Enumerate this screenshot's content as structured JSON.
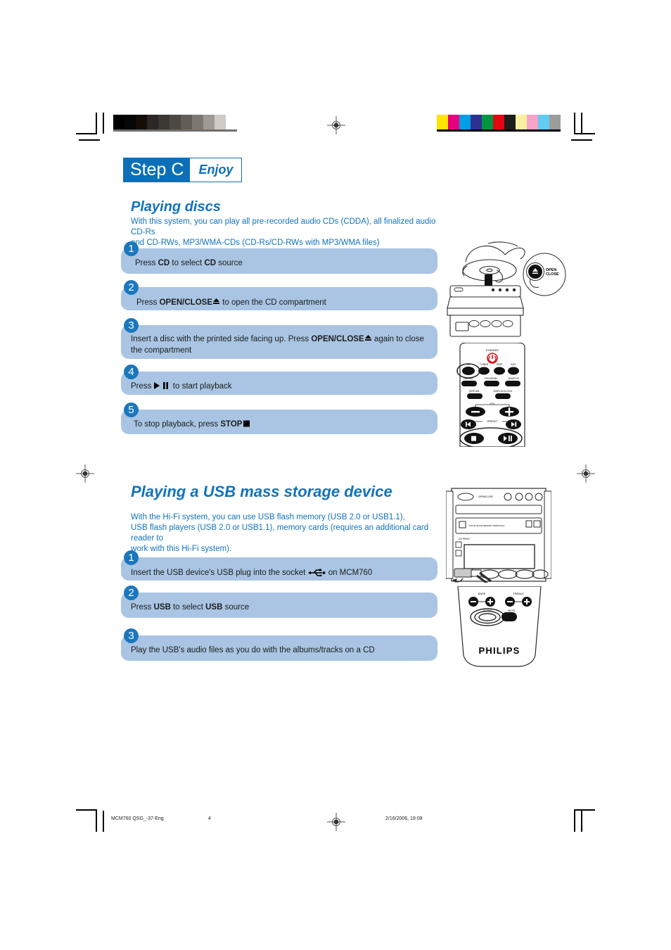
{
  "page": {
    "step_banner": {
      "step_label": "Step C",
      "enjoy_label": "Enjoy"
    },
    "calibration": {
      "gray_swatches": [
        "#000000",
        "#070707",
        "#140d08",
        "#2b2724",
        "#3b3733",
        "#4e4843",
        "#635c57",
        "#7e7771",
        "#a09a95",
        "#cfcac6",
        "#ffffff"
      ],
      "color_swatches": [
        "#ffe500",
        "#e6007e",
        "#009fe3",
        "#2e3192",
        "#009640",
        "#e30613",
        "#1d1d1b",
        "#fcf0a0",
        "#f5a3c7",
        "#62cbf2",
        "#9d9d9c"
      ]
    }
  },
  "discs": {
    "title": "Playing discs",
    "intro_line1": "With this system, you can play all pre-recorded audio CDs (CDDA), all finalized audio CD-Rs",
    "intro_line2": "and CD-RWs, MP3/WMA-CDs (CD-Rs/CD-RWs with MP3/WMA files)",
    "steps": [
      {
        "num": "1",
        "text_pre": "Press ",
        "bold1": "CD",
        "text_mid": " to select ",
        "bold2": "CD",
        "text_post": " source"
      },
      {
        "num": "2",
        "text_pre": "Press ",
        "bold1": "OPEN/CLOSE",
        "glyph": "eject",
        "text_post": " to open the CD compartment"
      },
      {
        "num": "3",
        "text_pre": "Insert a disc with the printed side facing up. Press ",
        "bold1": "OPEN/CLOSE",
        "glyph": "eject",
        "text_post": " again to close the compartment"
      },
      {
        "num": "4",
        "text_pre": "Press ",
        "glyph": "play-pause",
        "text_post": " to start playback"
      },
      {
        "num": "5",
        "text_pre": "To stop playback, press ",
        "bold1": "STOP",
        "glyph": "stop",
        "text_post": ""
      }
    ]
  },
  "usb": {
    "title": "Playing a USB mass storage device",
    "intro_line1": "With the Hi-Fi system, you can use USB flash memory (USB 2.0 or USB1.1),",
    "intro_line2": "USB flash players (USB 2.0 or USB1.1), memory cards (requires an additional card reader  to",
    "intro_line3": "work with this Hi-Fi system).",
    "steps": [
      {
        "num": "1",
        "text_pre": "Insert the USB device's USB plug into the socket ",
        "glyph": "usb",
        "text_post": " on MCM760"
      },
      {
        "num": "2",
        "text_pre": "Press ",
        "bold1": "USB",
        "text_mid": " to select ",
        "bold2": "USB",
        "text_post": " source"
      },
      {
        "num": "3",
        "text_pre": "Play the USB's audio files as you do with the albums/tracks on a CD",
        "text_post": ""
      }
    ]
  },
  "illustrations": {
    "cd_player": {
      "name": "cd-insert-illustration",
      "callout_line1": "OPEN",
      "callout_line2": "CLOSE"
    },
    "remote": {
      "name": "remote-control-illustration",
      "standby_label": "STANDBY",
      "source_buttons": [
        "CD",
        "TUNER",
        "TAPE",
        "AUX"
      ],
      "row2_buttons": [
        "REPEAT",
        "PROGRAM",
        "SHUFFLE"
      ],
      "row3_buttons": [
        "TAPE A/B",
        "DISPLAY/CLOCK"
      ],
      "vol_label": "VOL",
      "vol_minus": "–",
      "vol_plus": "+",
      "preset_label": "PRESET",
      "stop_label": "■",
      "play_label": "▶II"
    },
    "hifi_usb": {
      "name": "hifi-front-usb-illustration",
      "display_label": "CD PROG"
    },
    "remote_bottom": {
      "name": "remote-bottom-illustration",
      "bass_label": "BASS",
      "treble_label": "TREBLE",
      "sleep_label": "SLEEP",
      "mute_label": "MUTE",
      "brand": "PHILIPS"
    }
  },
  "footer": {
    "filename": "MCM760 QSG_-37-Eng",
    "page_number": "4",
    "timestamp": "2/16/2006, 19:08"
  }
}
